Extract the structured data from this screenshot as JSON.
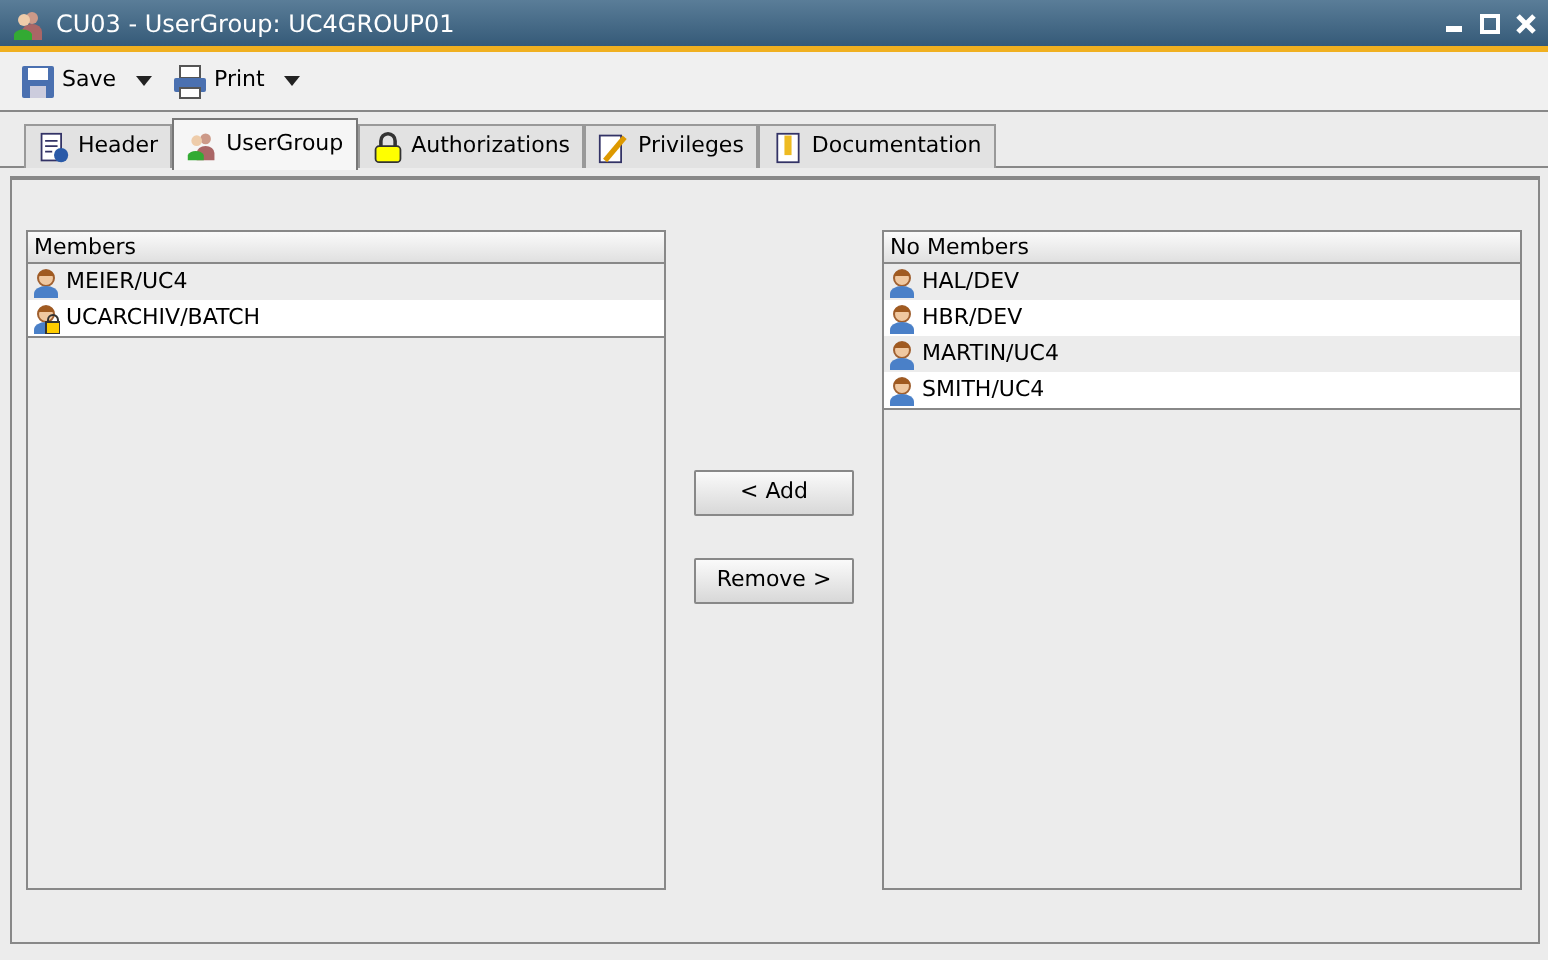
{
  "window": {
    "title": "CU03 - UserGroup: UC4GROUP01"
  },
  "toolbar": [
    {
      "label": "Save",
      "kind": "save"
    },
    {
      "label": "Print",
      "kind": "print"
    }
  ],
  "tabs": [
    {
      "label": "Header",
      "kind": "header",
      "selected": false
    },
    {
      "label": "UserGroup",
      "kind": "group",
      "selected": true
    },
    {
      "label": "Authorizations",
      "kind": "lock",
      "selected": false
    },
    {
      "label": "Privileges",
      "kind": "privileges",
      "selected": false
    },
    {
      "label": "Documentation",
      "kind": "doc",
      "selected": false
    }
  ],
  "members": {
    "heading": "Members",
    "items": [
      {
        "name": "MEIER/UC4",
        "kind": "user"
      },
      {
        "name": "UCARCHIV/BATCH",
        "kind": "locked-user"
      }
    ]
  },
  "buttons": [
    {
      "label": "< Add"
    },
    {
      "label": "Remove >"
    }
  ],
  "no_members": {
    "heading": "No Members",
    "items": [
      {
        "name": "HAL/DEV",
        "kind": "user"
      },
      {
        "name": "HBR/DEV",
        "kind": "user"
      },
      {
        "name": "MARTIN/UC4",
        "kind": "user"
      },
      {
        "name": "SMITH/UC4",
        "kind": "user"
      }
    ]
  }
}
